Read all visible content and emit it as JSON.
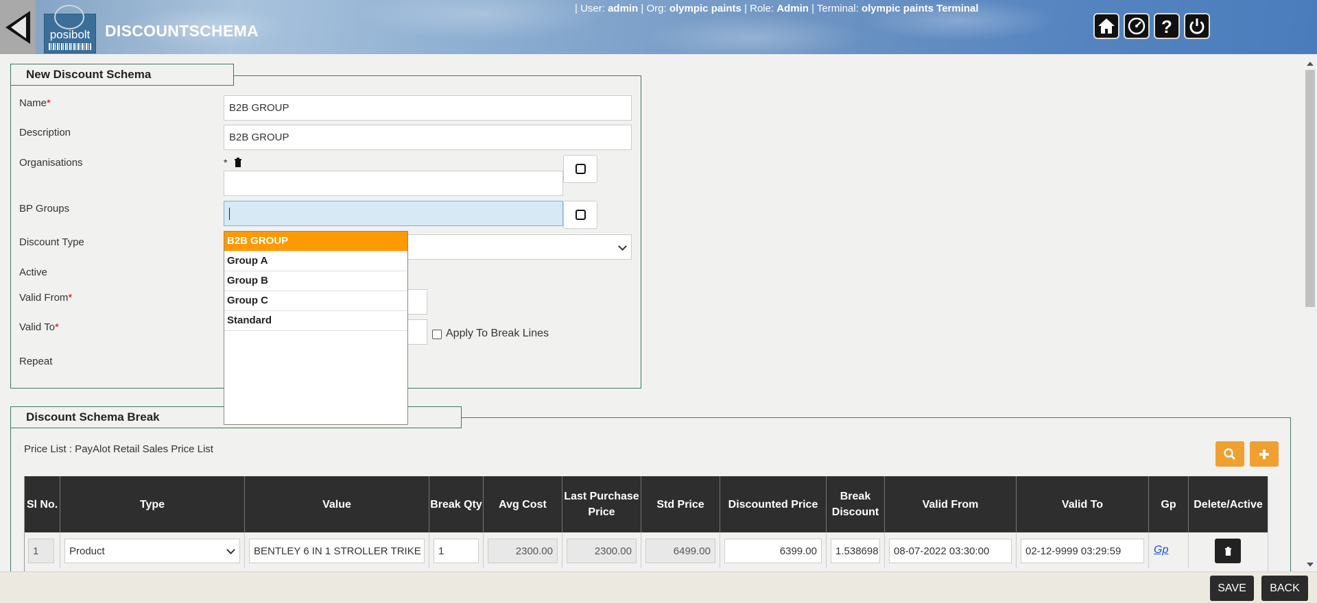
{
  "header": {
    "logo_text": "posibolt",
    "title": "DISCOUNTSCHEMA",
    "user_prefix": "| User: ",
    "user": "admin",
    "org_prefix": " | Org: ",
    "org": "olympic paints",
    "role_prefix": " | Role: ",
    "role": "Admin",
    "terminal_prefix": " | Terminal: ",
    "terminal": "olympic paints Terminal",
    "buttons": [
      "home-icon",
      "dashboard-icon",
      "help-icon",
      "power-icon"
    ]
  },
  "form": {
    "legend": "New Discount Schema",
    "labels": {
      "name": "Name",
      "description": "Description",
      "organisations": "Organisations",
      "bp_groups": "BP Groups",
      "discount_type": "Discount Type",
      "active": "Active",
      "valid_from": "Valid From",
      "valid_to": "Valid To",
      "repeat": "Repeat"
    },
    "required_mark": "*",
    "name_value": "B2B GROUP",
    "description_value": "B2B GROUP",
    "org_star": "*",
    "apply_break_lines": "Apply To Break Lines"
  },
  "bp_dropdown": {
    "items": [
      "B2B GROUP",
      "Group A",
      "Group B",
      "Group C",
      "Standard"
    ],
    "highlighted": "B2B GROUP"
  },
  "breaks": {
    "legend": "Discount Schema Break",
    "price_list": "Price List : PayAlot Retail Sales Price List",
    "columns": [
      "Sl No.",
      "Type",
      "Value",
      "Break Qty",
      "Avg Cost",
      "Last Purchase Price",
      "Std Price",
      "Discounted Price",
      "Break Discount",
      "Valid From",
      "Valid To",
      "Gp",
      "Delete/Active"
    ],
    "row": {
      "sl": "1",
      "type": "Product",
      "value": "BENTLEY 6 IN 1 STROLLER TRIKE",
      "break_qty": "1",
      "avg_cost": "2300.00",
      "last_purchase": "2300.00",
      "std_price": "6499.00",
      "discounted_price": "6399.00",
      "break_discount": "1.538698",
      "valid_from": "08-07-2022 03:30:00",
      "valid_to": "02-12-9999 03:29:59",
      "gp": "Gp"
    }
  },
  "footer": {
    "save": "SAVE",
    "back": "BACK"
  }
}
